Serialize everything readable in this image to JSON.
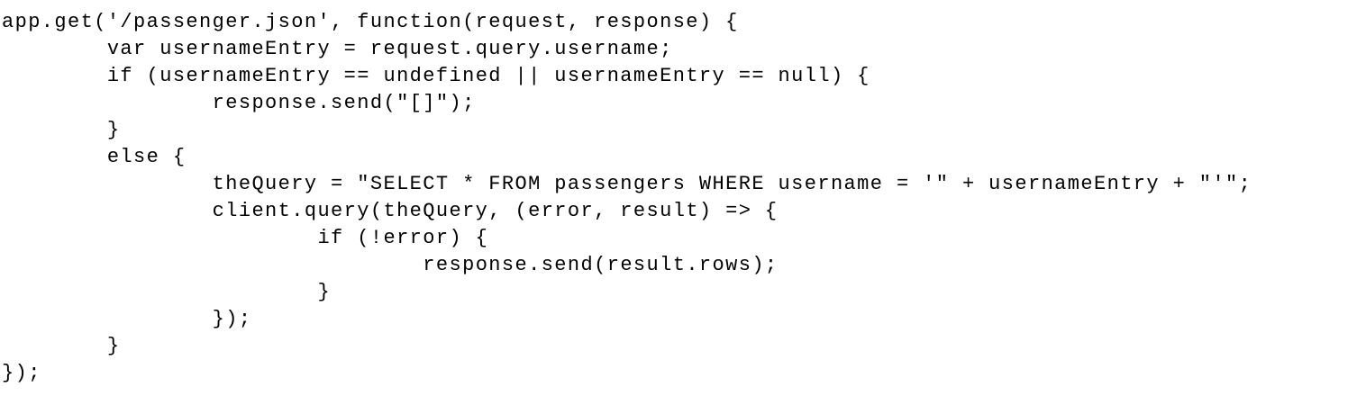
{
  "code": {
    "language": "javascript",
    "lines": [
      "app.get('/passenger.json', function(request, response) {",
      "\tvar usernameEntry = request.query.username;",
      "\tif (usernameEntry == undefined || usernameEntry == null) {",
      "\t\tresponse.send(\"[]\");",
      "\t}",
      "\telse {",
      "\t\ttheQuery = \"SELECT * FROM passengers WHERE username = '\" + usernameEntry + \"'\";",
      "\t\tclient.query(theQuery, (error, result) => {",
      "\t\t\tif (!error) {",
      "\t\t\t\tresponse.send(result.rows);",
      "\t\t\t}",
      "\t\t});",
      "\t}",
      "});"
    ]
  },
  "colors": {
    "background": "#ffffff",
    "text": "#000000"
  }
}
